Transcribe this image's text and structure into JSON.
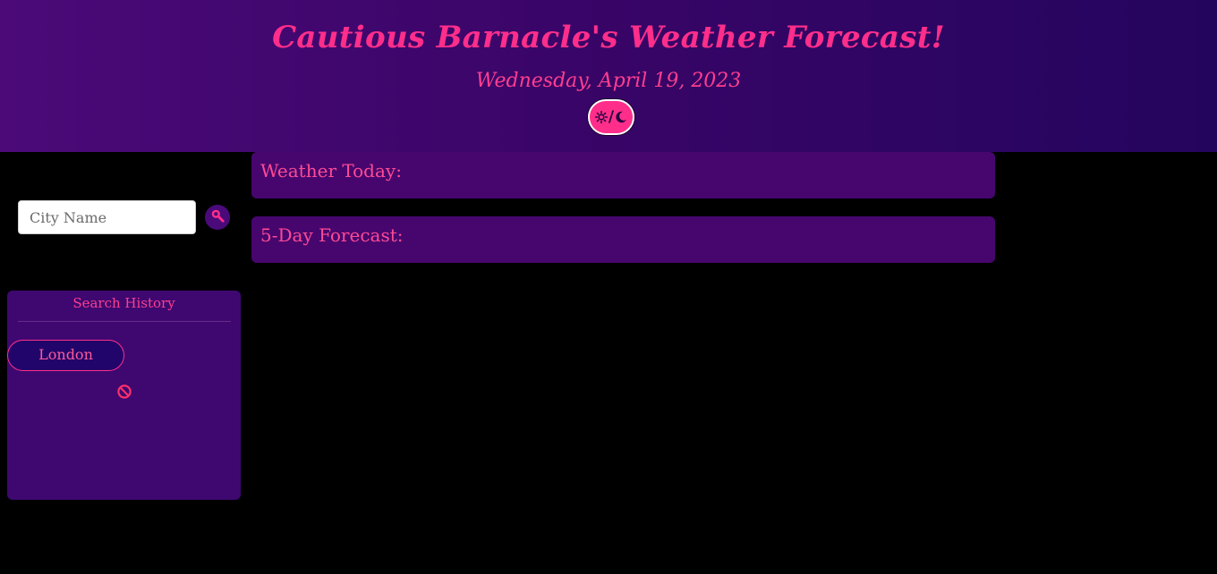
{
  "header": {
    "title": "Cautious Barnacle's Weather Forecast!",
    "date": "Wednesday, April 19, 2023",
    "theme_toggle": {
      "sun_icon": "sun-icon",
      "separator": "/",
      "moon_icon": "moon-icon"
    }
  },
  "search": {
    "placeholder": "City Name",
    "value": "",
    "button_icon": "magnifier-icon"
  },
  "history": {
    "title": "Search History",
    "items": [
      "London"
    ],
    "clear_icon": "prohibit-icon"
  },
  "main": {
    "today_title": "Weather Today:",
    "forecast_title": "5-Day Forecast:"
  },
  "colors": {
    "accent": "#ff2e8b",
    "header_gradient_start": "#4b0a78",
    "header_gradient_end": "#24055e",
    "panel_bg": "#3e0870",
    "card_bg": "#47066e",
    "page_bg": "#000000"
  }
}
